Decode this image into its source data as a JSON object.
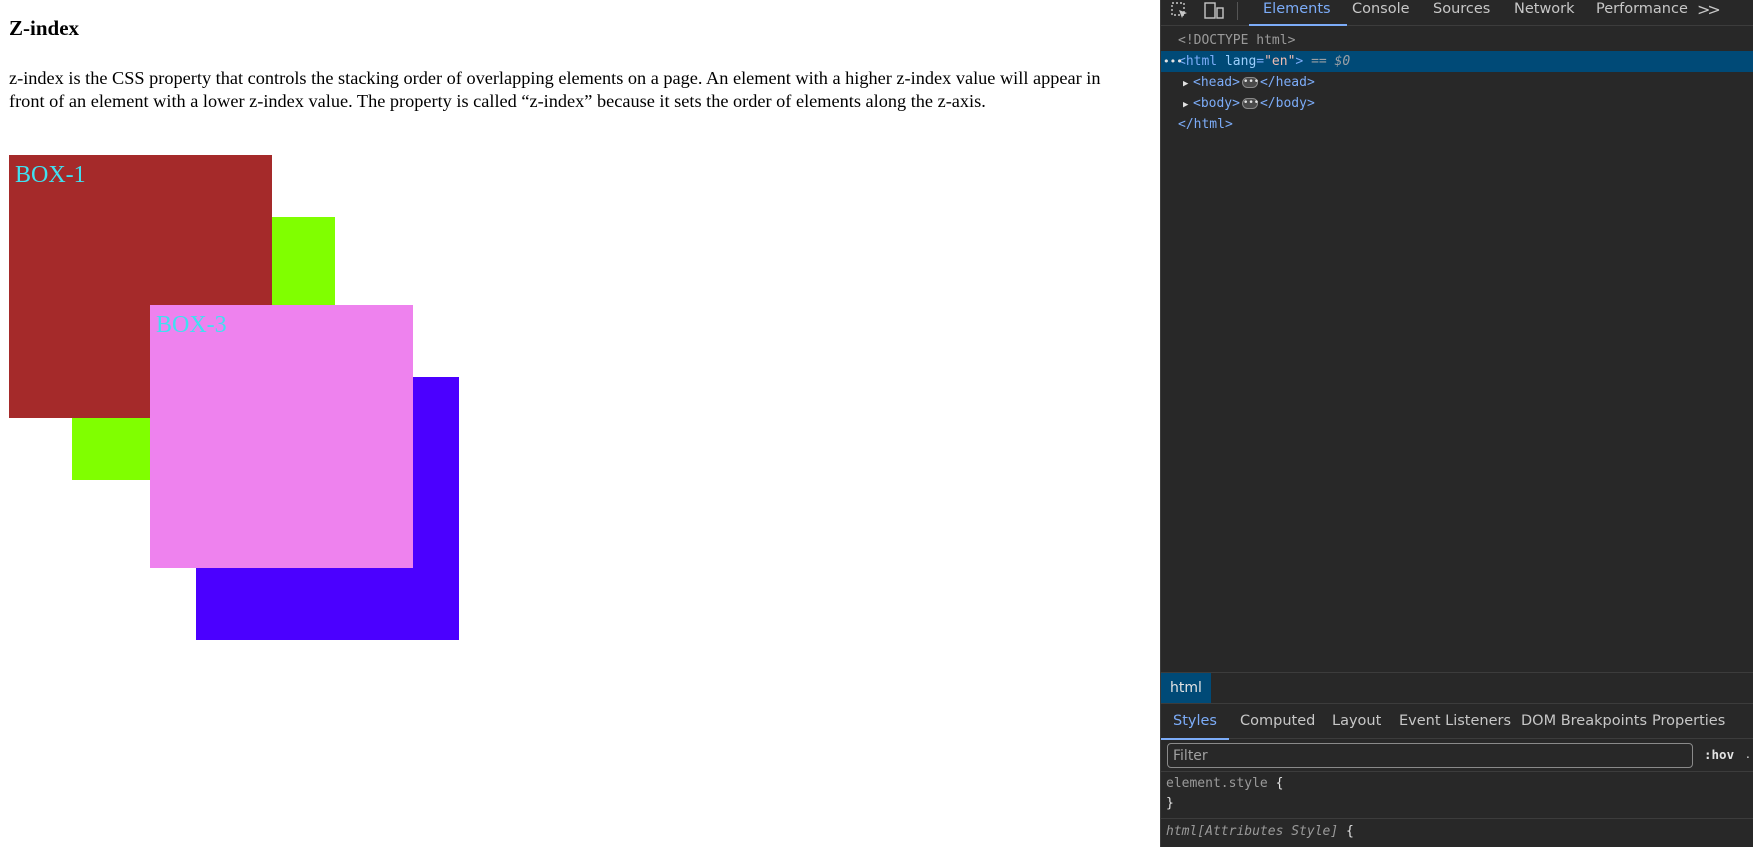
{
  "page": {
    "title": "Z-index",
    "paragraph": "z-index is the CSS property that controls the stacking order of overlapping elements on a page. An element with a higher z-index value will appear in front of an element with a lower z-index value. The property is called “z-index” because it sets the order of elements along the z-axis.",
    "boxes": [
      {
        "label": "BOX-1",
        "color": "#a52a2a",
        "label_color": "#40e0f0"
      },
      {
        "label": "",
        "color": "#80ff00",
        "label_color": "#40e0f0"
      },
      {
        "label": "BOX-3",
        "color": "#ee82ee",
        "label_color": "#40e0f0"
      },
      {
        "label": "",
        "color": "#4b00ff",
        "label_color": "#40e0f0"
      }
    ]
  },
  "devtools": {
    "toolbar": {
      "icons": [
        "inspect-element-icon",
        "device-toolbar-icon"
      ],
      "tabs": [
        "Elements",
        "Console",
        "Sources",
        "Network",
        "Performance"
      ],
      "active_tab": "Elements",
      "more": ">>"
    },
    "dom": {
      "doctype": "<!DOCTYPE html>",
      "html_open_tag": "html",
      "html_attr_name": "lang",
      "html_attr_value": "\"en\"",
      "selected_marker": "== $0",
      "head_tag": "head",
      "body_tag": "body",
      "html_close": "</html>"
    },
    "breadcrumb": "html",
    "sub_tabs": [
      "Styles",
      "Computed",
      "Layout",
      "Event Listeners",
      "DOM Breakpoints",
      "Properties"
    ],
    "active_sub_tab": "Styles",
    "filter_placeholder": "Filter",
    "hov_label": ":hov",
    "styles": {
      "element_style_selector": "element.style",
      "open_brace": "{",
      "close_brace": "}",
      "attr_style_selector": "html[Attributes Style]"
    },
    "colors": {
      "accent": "#7cacf8",
      "selected_row": "#004a77",
      "background": "#282828"
    }
  }
}
